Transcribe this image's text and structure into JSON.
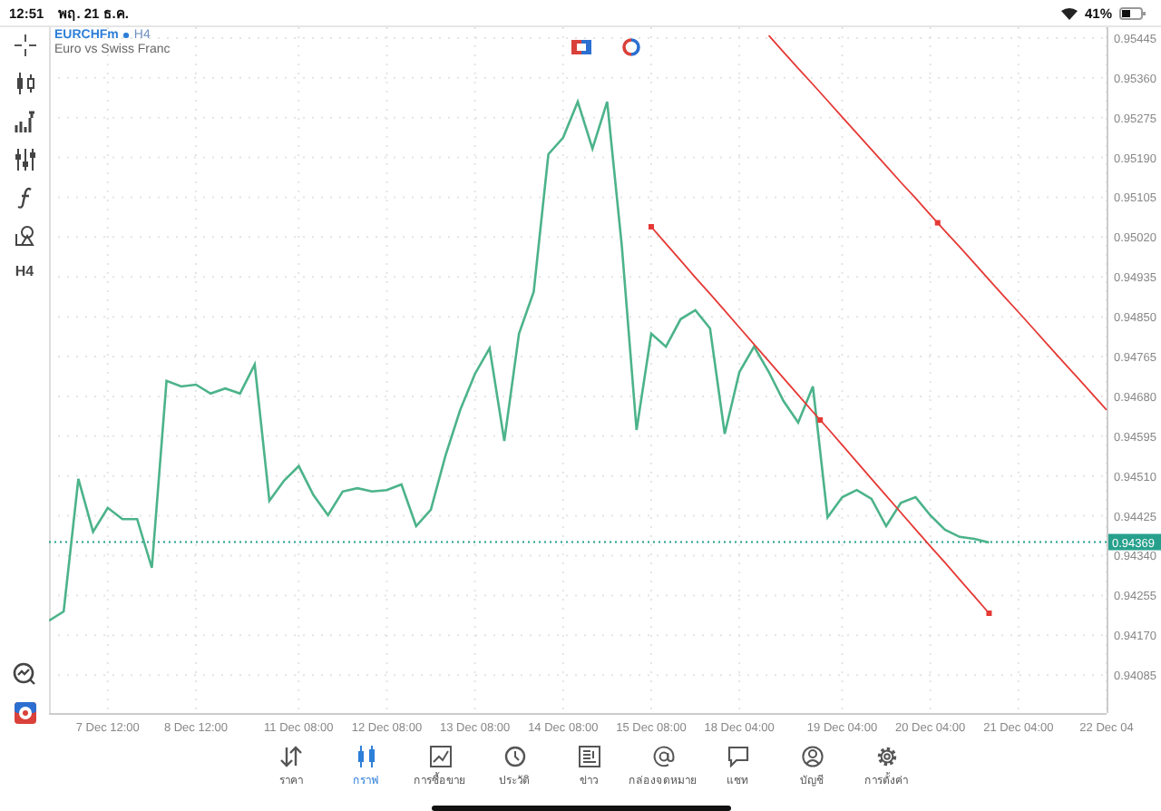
{
  "status_bar": {
    "time": "12:51",
    "date": "พฤ. 21 ธ.ค.",
    "battery": "41%"
  },
  "toolbar": {
    "timeframe": "H4"
  },
  "chart": {
    "symbol": "EURCHFm",
    "timeframe": "H4",
    "description": "Euro vs Swiss Franc",
    "chart_data": {
      "type": "line",
      "grid": true,
      "categories": [
        null,
        null,
        null,
        null,
        "7 Dec 12:00",
        null,
        null,
        null,
        null,
        null,
        "8 Dec 12:00",
        null,
        null,
        null,
        null,
        null,
        null,
        "11 Dec 08:00",
        null,
        null,
        null,
        null,
        null,
        "12 Dec 08:00",
        null,
        null,
        null,
        null,
        null,
        "13 Dec 08:00",
        null,
        null,
        null,
        null,
        null,
        "14 Dec 08:00",
        null,
        null,
        null,
        null,
        null,
        "15 Dec 08:00",
        null,
        null,
        null,
        null,
        null,
        "18 Dec 04:00",
        null,
        null,
        null,
        null,
        null,
        null,
        "19 Dec 04:00",
        null,
        null,
        null,
        null,
        null,
        "20 Dec 04:00",
        null,
        null,
        null,
        null,
        null,
        "21 Dec 04:00",
        null,
        null,
        null,
        null,
        null,
        "22 Dec 04"
      ],
      "series": [
        {
          "color": "#4cb38a",
          "values": [
            0.94201,
            0.94221,
            0.94504,
            0.94391,
            0.94442,
            0.94418,
            0.94418,
            0.94314,
            0.94713,
            0.94701,
            0.94705,
            0.94686,
            0.94697,
            0.94686,
            0.94748,
            0.94457,
            0.945,
            0.94531,
            0.94469,
            0.94426,
            0.94477,
            0.94484,
            0.94477,
            0.9448,
            0.94492,
            0.94403,
            0.94438,
            0.94554,
            0.94651,
            0.94728,
            0.94783,
            0.94585,
            0.94814,
            0.94903,
            0.95197,
            0.95232,
            0.95309,
            0.95209,
            0.95309,
            0.95,
            0.94608,
            0.94814,
            0.94786,
            0.94845,
            0.94864,
            0.94825,
            0.946,
            0.94732,
            0.94786,
            0.94732,
            0.9467,
            0.94624,
            0.94701,
            0.94422,
            0.94465,
            0.9448,
            0.94461,
            0.94403,
            0.94453,
            0.94465,
            0.94426,
            0.94395,
            0.9438,
            0.94376,
            0.94368,
            null,
            null,
            null,
            null,
            null,
            null,
            null,
            null
          ]
        },
        {
          "color": "#e53935",
          "values": [
            null,
            null,
            null,
            null,
            null,
            null,
            null,
            null,
            null,
            null,
            null,
            null,
            null,
            null,
            null,
            null,
            null,
            null,
            null,
            null,
            null,
            null,
            null,
            null,
            null,
            null,
            null,
            null,
            null,
            null,
            null,
            null,
            null,
            null,
            null,
            null,
            null,
            null,
            null,
            null,
            null,
            0.95042,
            0.95006,
            0.9497,
            0.94934,
            0.94899,
            0.94863,
            0.94827,
            0.94791,
            0.94755,
            0.94719,
            0.94683,
            0.94647,
            0.94612,
            0.94576,
            0.9454,
            0.94504,
            0.94468,
            0.94432,
            0.94396,
            0.9436,
            0.94325,
            0.94289,
            0.94253,
            0.94217,
            null,
            null,
            null,
            null,
            null,
            null,
            null,
            null
          ]
        },
        {
          "color": "#e53935",
          "values": [
            null,
            null,
            null,
            null,
            null,
            null,
            null,
            null,
            null,
            null,
            null,
            null,
            null,
            null,
            null,
            null,
            null,
            null,
            null,
            null,
            null,
            null,
            null,
            null,
            null,
            null,
            null,
            null,
            null,
            null,
            null,
            null,
            null,
            null,
            null,
            null,
            null,
            null,
            null,
            null,
            null,
            null,
            null,
            null,
            null,
            null,
            null,
            null,
            null,
            0.9545,
            0.95415,
            0.9538,
            0.95346,
            0.95311,
            0.95276,
            0.95242,
            0.95207,
            0.95172,
            0.95137,
            0.95103,
            0.95068,
            0.95033,
            0.94999,
            0.94964,
            0.94929,
            0.94894,
            0.9486,
            0.94825,
            0.9479,
            0.94755,
            0.94721,
            0.94686,
            0.94651
          ]
        }
      ],
      "ylim": [
        0.94004,
        0.95468
      ],
      "yticks": [
        {
          "value": 0.95445,
          "label": "0.95445"
        },
        {
          "value": 0.9536,
          "label": "0.95360"
        },
        {
          "value": 0.95275,
          "label": "0.95275"
        },
        {
          "value": 0.9519,
          "label": "0.95190"
        },
        {
          "value": 0.95105,
          "label": "0.95105"
        },
        {
          "value": 0.9502,
          "label": "0.95020"
        },
        {
          "value": 0.94935,
          "label": "0.94935"
        },
        {
          "value": 0.9485,
          "label": "0.94850"
        },
        {
          "value": 0.94765,
          "label": "0.94765"
        },
        {
          "value": 0.9468,
          "label": "0.94680"
        },
        {
          "value": 0.94595,
          "label": "0.94595"
        },
        {
          "value": 0.9451,
          "label": "0.94510"
        },
        {
          "value": 0.94425,
          "label": "0.94425"
        },
        {
          "value": 0.9434,
          "label": "0.94340"
        },
        {
          "value": 0.94255,
          "label": "0.94255"
        },
        {
          "value": 0.9417,
          "label": "0.94170"
        },
        {
          "value": 0.94085,
          "label": "0.94085"
        }
      ],
      "ref_lines": [
        {
          "axis": "y",
          "value": 0.94369,
          "label": "0.94369",
          "color": "#26a08c"
        }
      ]
    }
  },
  "nav": [
    {
      "label": "ราคา",
      "selected": false
    },
    {
      "label": "กราฟ",
      "selected": true
    },
    {
      "label": "การซื้อขาย",
      "selected": false
    },
    {
      "label": "ประวัติ",
      "selected": false
    },
    {
      "label": "ข่าว",
      "selected": false
    },
    {
      "label": "กล่องจดหมาย",
      "selected": false
    },
    {
      "label": "แชท",
      "selected": false
    },
    {
      "label": "บัญชี",
      "selected": false
    },
    {
      "label": "การตั้งค่า",
      "selected": false
    }
  ]
}
